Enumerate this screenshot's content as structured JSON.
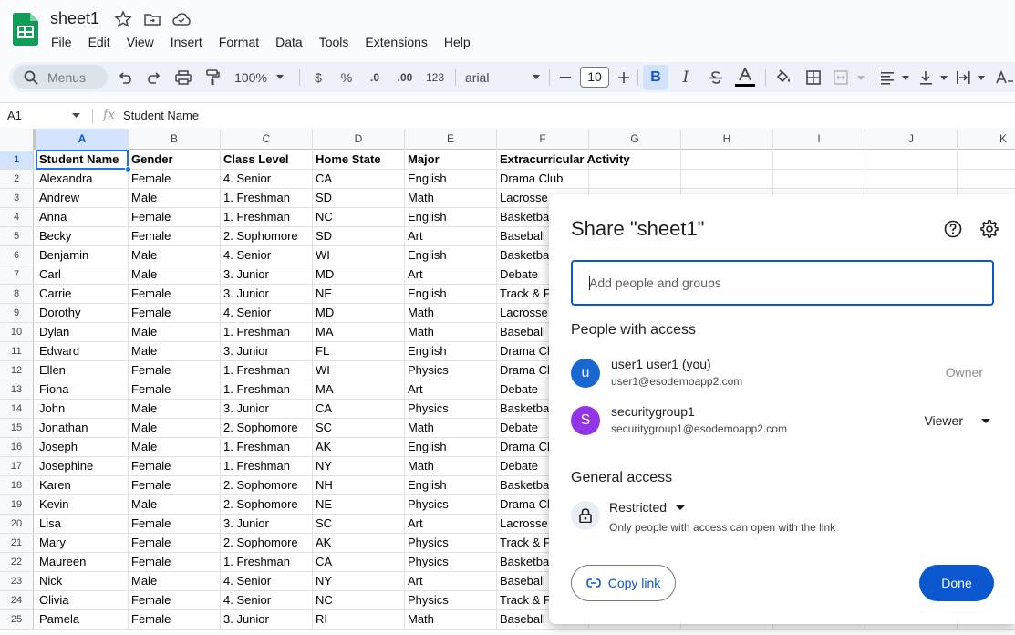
{
  "header": {
    "doc_title": "sheet1",
    "menus": [
      "File",
      "Edit",
      "View",
      "Insert",
      "Format",
      "Data",
      "Tools",
      "Extensions",
      "Help"
    ],
    "brand_color": "#0f9d58"
  },
  "toolbar": {
    "search_placeholder": "Menus",
    "zoom": "100%",
    "currency": "$",
    "percent": "%",
    "dec_decrease": ".0",
    "dec_increase": ".00",
    "number_format": "123",
    "font": "arial",
    "font_size": "10",
    "bold": "B",
    "italic": "I"
  },
  "formula_bar": {
    "cell_ref": "A1",
    "fx": "fx",
    "content": "Student Name"
  },
  "grid": {
    "columns": [
      "A",
      "B",
      "C",
      "D",
      "E",
      "F",
      "G",
      "H",
      "I",
      "J",
      "K"
    ],
    "header_row": [
      "Student Name",
      "Gender",
      "Class Level",
      "Home State",
      "Major",
      "Extracurricular Activity"
    ],
    "rows": [
      [
        "Alexandra",
        "Female",
        "4. Senior",
        "CA",
        "English",
        "Drama Club"
      ],
      [
        "Andrew",
        "Male",
        "1. Freshman",
        "SD",
        "Math",
        "Lacrosse"
      ],
      [
        "Anna",
        "Female",
        "1. Freshman",
        "NC",
        "English",
        "Basketball"
      ],
      [
        "Becky",
        "Female",
        "2. Sophomore",
        "SD",
        "Art",
        "Baseball"
      ],
      [
        "Benjamin",
        "Male",
        "4. Senior",
        "WI",
        "English",
        "Basketball"
      ],
      [
        "Carl",
        "Male",
        "3. Junior",
        "MD",
        "Art",
        "Debate"
      ],
      [
        "Carrie",
        "Female",
        "3. Junior",
        "NE",
        "English",
        "Track & Field"
      ],
      [
        "Dorothy",
        "Female",
        "4. Senior",
        "MD",
        "Math",
        "Lacrosse"
      ],
      [
        "Dylan",
        "Male",
        "1. Freshman",
        "MA",
        "Math",
        "Baseball"
      ],
      [
        "Edward",
        "Male",
        "3. Junior",
        "FL",
        "English",
        "Drama Club"
      ],
      [
        "Ellen",
        "Female",
        "1. Freshman",
        "WI",
        "Physics",
        "Drama Club"
      ],
      [
        "Fiona",
        "Female",
        "1. Freshman",
        "MA",
        "Art",
        "Debate"
      ],
      [
        "John",
        "Male",
        "3. Junior",
        "CA",
        "Physics",
        "Basketball"
      ],
      [
        "Jonathan",
        "Male",
        "2. Sophomore",
        "SC",
        "Math",
        "Debate"
      ],
      [
        "Joseph",
        "Male",
        "1. Freshman",
        "AK",
        "English",
        "Drama Club"
      ],
      [
        "Josephine",
        "Female",
        "1. Freshman",
        "NY",
        "Math",
        "Debate"
      ],
      [
        "Karen",
        "Female",
        "2. Sophomore",
        "NH",
        "English",
        "Basketball"
      ],
      [
        "Kevin",
        "Male",
        "2. Sophomore",
        "NE",
        "Physics",
        "Drama Club"
      ],
      [
        "Lisa",
        "Female",
        "3. Junior",
        "SC",
        "Art",
        "Lacrosse"
      ],
      [
        "Mary",
        "Female",
        "2. Sophomore",
        "AK",
        "Physics",
        "Track & Field"
      ],
      [
        "Maureen",
        "Female",
        "1. Freshman",
        "CA",
        "Physics",
        "Basketball"
      ],
      [
        "Nick",
        "Male",
        "4. Senior",
        "NY",
        "Art",
        "Baseball"
      ],
      [
        "Olivia",
        "Female",
        "4. Senior",
        "NC",
        "Physics",
        "Track & Field"
      ],
      [
        "Pamela",
        "Female",
        "3. Junior",
        "RI",
        "Math",
        "Baseball"
      ]
    ]
  },
  "share_dialog": {
    "title": "Share \"sheet1\"",
    "add_placeholder": "Add people and groups",
    "people_title": "People with access",
    "people": [
      {
        "initial": "u",
        "name": "user1 user1 (you)",
        "email": "user1@esodemoapp2.com",
        "role": "Owner",
        "color": "#1967d2"
      },
      {
        "initial": "S",
        "name": "securitygroup1",
        "email": "securitygroup1@esodemoapp2.com",
        "role": "Viewer",
        "color": "#9334e6"
      }
    ],
    "general_title": "General access",
    "access_level": "Restricted",
    "access_desc": "Only people with access can open with the link",
    "copy_link": "Copy link",
    "done": "Done"
  }
}
